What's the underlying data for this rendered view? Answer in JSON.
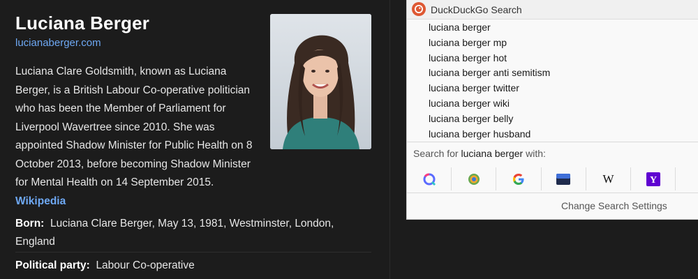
{
  "panel": {
    "name": "Luciana Berger",
    "website": "lucianaberger.com",
    "description": "Luciana Clare Goldsmith, known as Luciana Berger, is a British Labour Co-operative politician who has been the Member of Parliament for Liverpool Wavertree since 2010. She was appointed Shadow Minister for Public Health on 8 October 2013, before becoming Shadow Minister for Mental Health on 14 September 2015.",
    "source_link": "Wikipedia",
    "facts": {
      "born_label": "Born:",
      "born_value": "Luciana Clare Berger, May 13, 1981, Westminster, London, England",
      "party_label": "Political party:",
      "party_value": "Labour Co-operative"
    }
  },
  "dropdown": {
    "title": "DuckDuckGo Search",
    "suggestions": [
      "luciana berger",
      "luciana berger mp",
      "luciana berger hot",
      "luciana berger anti semitism",
      "luciana berger twitter",
      "luciana berger wiki",
      "luciana berger belly",
      "luciana berger husband"
    ],
    "search_for_prefix": "Search for",
    "search_for_query": "luciana berger",
    "search_for_suffix": "with:",
    "engines": [
      "qwant-icon",
      "startpage-icon",
      "google-icon",
      "bing-icon",
      "wikipedia-icon",
      "yahoo-icon"
    ],
    "change_settings": "Change Search Settings"
  },
  "colors": {
    "panel_bg": "#1c1c1c",
    "link": "#6ea8f3",
    "ddg_brand": "#de5833"
  }
}
